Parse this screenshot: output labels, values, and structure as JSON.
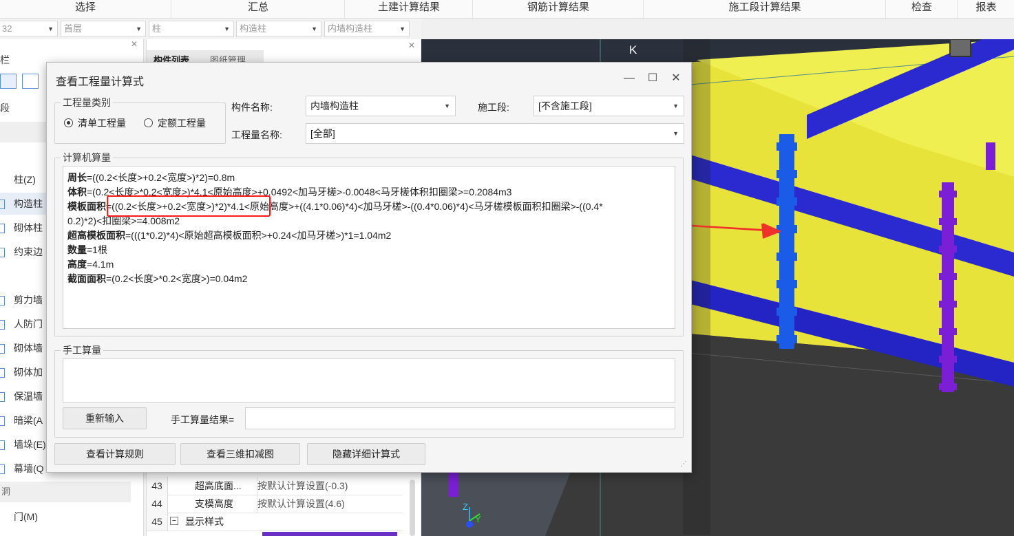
{
  "top_tabs": [
    "选择",
    "汇总",
    "土建计算结果",
    "钢筋计算结果",
    "施工段计算结果",
    "检查",
    "报表"
  ],
  "filters": [
    {
      "value": "32"
    },
    {
      "value": "首层"
    },
    {
      "value": "柱"
    },
    {
      "value": "构造柱"
    },
    {
      "value": "内墙构造柱"
    }
  ],
  "left_panel": {
    "header": "栏",
    "section_label": "段",
    "items": [
      "柱(Z)",
      "构造柱",
      "砌体柱",
      "约束边",
      "剪力墙",
      "人防门",
      "砌体墙",
      "砌体加",
      "保温墙",
      "暗梁(A",
      "墙垛(E)",
      "幕墙(Q"
    ],
    "group_bottom": "洞",
    "door_item": "门(M)"
  },
  "mid_panel": {
    "tabs": [
      "构件列表",
      "图纸管理"
    ],
    "rows": [
      {
        "num": "43",
        "name": "超高底面...",
        "value": "按默认计算设置(-0.3)"
      },
      {
        "num": "44",
        "name": "支模高度",
        "value": "按默认计算设置(4.6)"
      },
      {
        "num": "45",
        "name": "显示样式",
        "value": ""
      }
    ],
    "collapse_symbol": "−"
  },
  "viewport": {
    "axis_label": "K",
    "axis_z": "Z",
    "axis_y": "Y"
  },
  "dialog": {
    "title": "查看工程量计算式",
    "controls": {
      "minimize": "—",
      "maximize": "☐",
      "close": "✕"
    },
    "qty_type_group": "工程量类别",
    "radio_list": "清单工程量",
    "radio_quota": "定额工程量",
    "component_name_label": "构件名称:",
    "component_name_value": "内墙构造柱",
    "stage_label": "施工段:",
    "stage_value": "[不含施工段]",
    "qty_name_label": "工程量名称:",
    "qty_name_value": "[全部]",
    "computer_group": "计算机算量",
    "formulas": [
      {
        "label": "周长",
        "text": "=((0.2<长度>+0.2<宽度>)*2)=0.8m"
      },
      {
        "label": "体积",
        "text": "=(0.2<长度>*0.2<宽度>)*4.1<原始高度>+0.0492<加马牙槎>-0.0048<马牙槎体积扣圈梁>=0.2084m3"
      },
      {
        "label": "模板面积",
        "text": "=((0.2<长度>+0.2<宽度>)*2)*4.1<原始高度>+((4.1*0.06)*4)<加马牙槎>-((0.4*0.06)*4)<马牙槎模板面积扣圈梁>-((0.4*"
      },
      {
        "label": "",
        "text": "0.2)*2)<扣圈梁>=4.008m2"
      },
      {
        "label": "超高模板面积",
        "text": "=(((1*0.2)*4)<原始超高模板面积>+0.24<加马牙槎>)*1=1.04m2"
      },
      {
        "label": "数量",
        "text": "=1根"
      },
      {
        "label": "高度",
        "text": "=4.1m"
      },
      {
        "label": "截面面积",
        "text": "=(0.2<长度>*0.2<宽度>)=0.04m2"
      }
    ],
    "manual_group": "手工算量",
    "reenter_button": "重新输入",
    "manual_result_label": "手工算量结果=",
    "manual_result_value": "",
    "btn_rules": "查看计算规则",
    "btn_3d": "查看三维扣减图",
    "btn_hide": "隐藏详细计算式",
    "resize_grip": "⋰"
  },
  "colors": {
    "highlight": "#ff1a1a",
    "arrow": "#f0302a",
    "wall": "#e8e33a",
    "beam": "#2222cc",
    "column_blue": "#1a5ce8",
    "column_purple": "#7a1fd6"
  }
}
